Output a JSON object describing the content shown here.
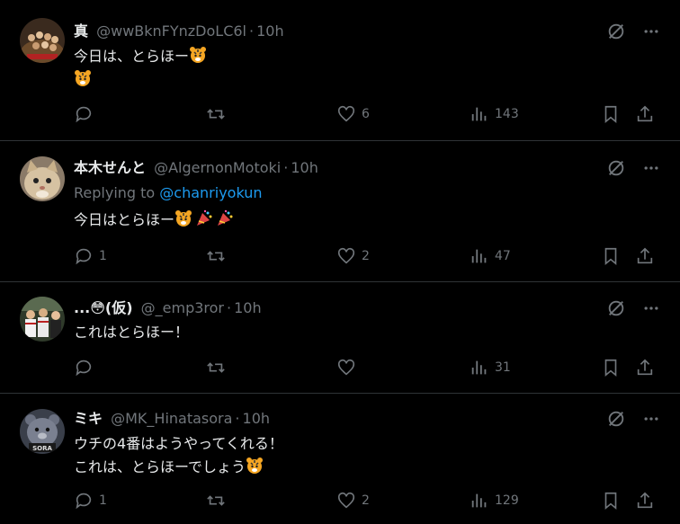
{
  "colors": {
    "background": "#000000",
    "text": "#e7e9ea",
    "muted": "#71767b",
    "link": "#1d9bf0",
    "divider": "#2f3336"
  },
  "tweets": [
    {
      "name": "真",
      "handle": "@wwBknFYnzDoLC6l",
      "dot": "·",
      "time": "10h",
      "body_lines": [
        "今日は、とらほー",
        ""
      ],
      "reply_count": "",
      "like_count": "6",
      "view_count": "143",
      "avatar_icon": "team-photo-avatar"
    },
    {
      "name": "本木せんと",
      "handle": "@AlgernonMotoki",
      "dot": "·",
      "time": "10h",
      "replying_to_label": "Replying to",
      "replying_to_handle": "@chanriyokun",
      "body_lines": [
        "今日はとらほー"
      ],
      "reply_count": "1",
      "like_count": "2",
      "view_count": "47",
      "avatar_icon": "cat-avatar"
    },
    {
      "name": "...😳(仮)",
      "handle": "@_emp3ror",
      "dot": "·",
      "time": "10h",
      "body_lines": [
        "これはとらほー！"
      ],
      "reply_count": "",
      "like_count": "",
      "view_count": "31",
      "avatar_icon": "players-avatar"
    },
    {
      "name": "ミキ",
      "handle": "@MK_Hinatasora",
      "dot": "·",
      "time": "10h",
      "body_lines": [
        "ウチの4番はようやってくれる！",
        "これは、とらほーでしょう"
      ],
      "reply_count": "1",
      "like_count": "2",
      "view_count": "129",
      "avatar_icon": "bear-sora-avatar",
      "avatar_text": "SORA"
    }
  ]
}
